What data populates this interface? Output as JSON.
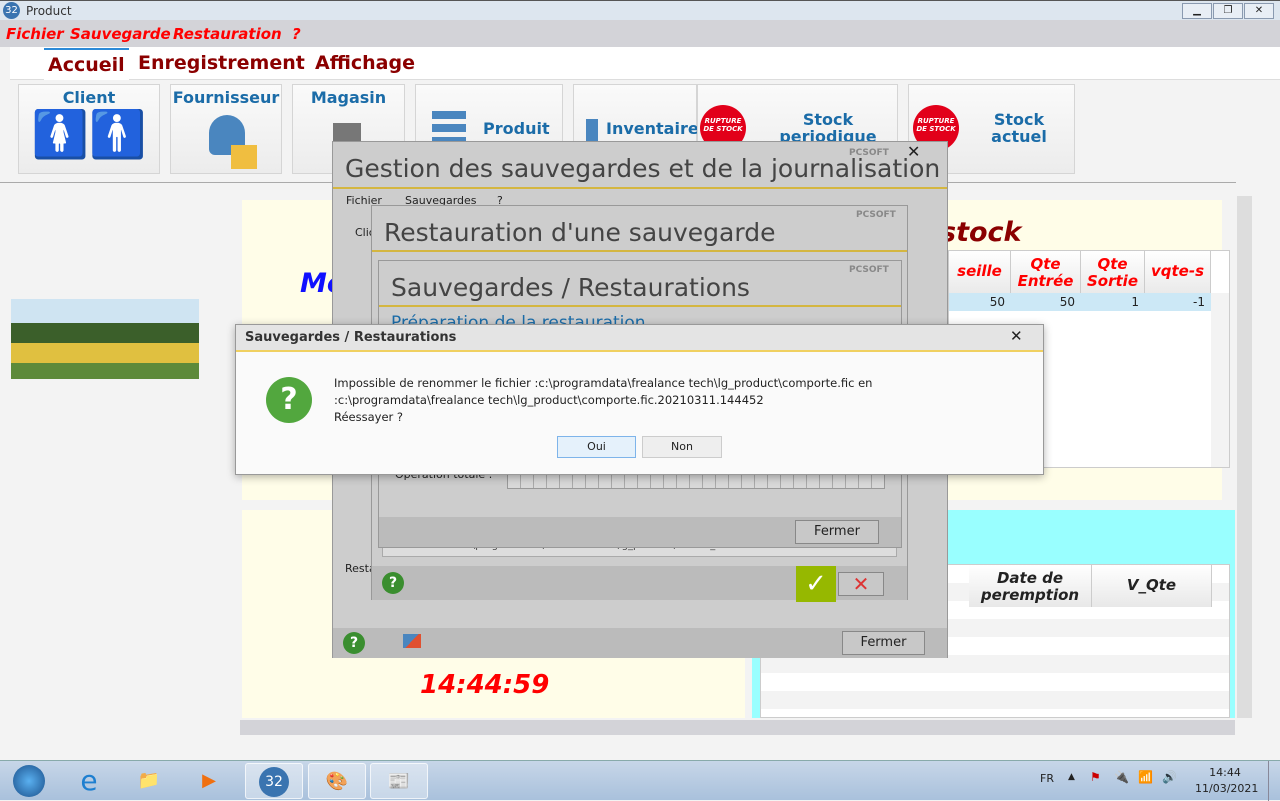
{
  "window": {
    "title": "Product",
    "app_icon": "32"
  },
  "menu": [
    "Fichier",
    "Sauvegarde",
    "Restauration",
    "?"
  ],
  "tabs": [
    "Accueil",
    "Enregistrement",
    "Affichage"
  ],
  "ribbon": {
    "client": "Client",
    "fournisseur": "Fournisseur",
    "magasin": "Magasin",
    "produit": "Produit",
    "inventaire": "Inventaire",
    "stock_periodique": "Stock periodique",
    "stock_actuel": "Stock actuel",
    "rupture_badge": "RUPTURE DE STOCK"
  },
  "main": {
    "title_partial": "Mo",
    "stock_title": "stock",
    "clock": "14:44:59",
    "stock_table": {
      "headers": [
        "seille",
        "Qte Entrée",
        "Qte Sortie",
        "vqte-s"
      ],
      "rows": [
        [
          "50",
          "50",
          "1",
          "-1"
        ]
      ]
    },
    "bottom_table": {
      "headers": [
        "Date de peremption",
        "V_Qte"
      ]
    }
  },
  "dialog_gestion": {
    "title": "Gestion des sauvegardes et de la journalisation",
    "brand": "PCSOFT",
    "menu": [
      "Fichier",
      "Sauvegardes",
      "?"
    ],
    "label_partial": "Clic",
    "label_resta": "Resta",
    "close": "Fermer"
  },
  "dialog_restauration": {
    "title": "Restauration d'une sauvegarde",
    "brand": "PCSOFT",
    "path_partial": "c:\\programdata\\frealance tech\\lg_product\\facture_ventes"
  },
  "dialog_sauvegardes": {
    "title": "Sauvegardes / Restaurations",
    "brand": "PCSOFT",
    "subtitle": "Préparation de la restauration",
    "op_label": "Opération totale :",
    "progress": 0,
    "close": "Fermer"
  },
  "message_box": {
    "title": "Sauvegardes / Restaurations",
    "line1": "Impossible de renommer le fichier :c:\\programdata\\frealance tech\\lg_product\\comporte.fic en",
    "line2": ":c:\\programdata\\frealance tech\\lg_product\\comporte.fic.20210311.144452",
    "line3": "Réessayer ?",
    "yes": "Oui",
    "no": "Non"
  },
  "taskbar": {
    "lang": "FR",
    "time": "14:44",
    "date": "11/03/2021"
  }
}
